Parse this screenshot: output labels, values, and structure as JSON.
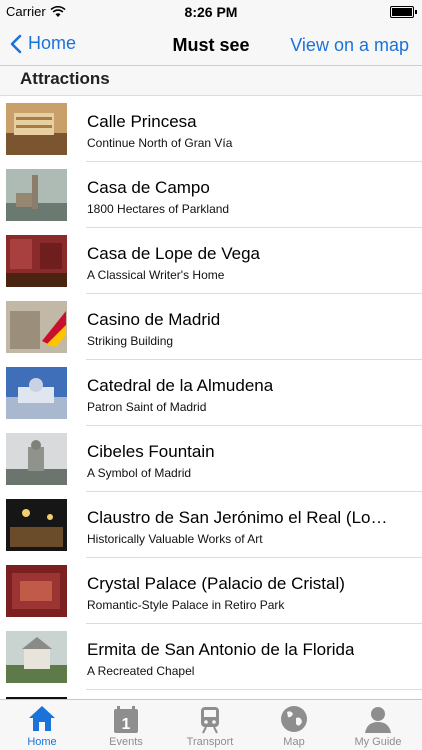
{
  "status_bar": {
    "carrier": "Carrier",
    "time": "8:26 PM",
    "battery_level": 1.0
  },
  "nav": {
    "back_label": "Home",
    "title": "Must see",
    "map_label": "View on a map"
  },
  "section": {
    "title": "Attractions"
  },
  "items": [
    {
      "title": "Calle Princesa",
      "subtitle": "Continue North of Gran Vía"
    },
    {
      "title": "Casa de Campo",
      "subtitle": "1800 Hectares of Parkland"
    },
    {
      "title": "Casa de Lope de Vega",
      "subtitle": "A Classical Writer's Home"
    },
    {
      "title": "Casino de Madrid",
      "subtitle": "Striking Building"
    },
    {
      "title": "Catedral de la Almudena",
      "subtitle": "Patron Saint of Madrid"
    },
    {
      "title": "Cibeles Fountain",
      "subtitle": "A Symbol of Madrid"
    },
    {
      "title": "Claustro de San Jerónimo el Real (Lo…",
      "subtitle": "Historically Valuable Works of Art"
    },
    {
      "title": "Crystal Palace (Palacio de Cristal)",
      "subtitle": "Romantic-Style Palace in Retiro Park"
    },
    {
      "title": "Ermita de San Antonio de la Florida",
      "subtitle": "A Recreated Chapel"
    }
  ],
  "tabs": [
    {
      "label": "Home",
      "icon": "home-icon",
      "active": true
    },
    {
      "label": "Events",
      "icon": "calendar-icon",
      "active": false
    },
    {
      "label": "Transport",
      "icon": "train-icon",
      "active": false
    },
    {
      "label": "Map",
      "icon": "globe-icon",
      "active": false
    },
    {
      "label": "My Guide",
      "icon": "person-icon",
      "active": false
    }
  ],
  "colors": {
    "accent": "#1a73d9",
    "inactive": "#8e8e8e"
  }
}
